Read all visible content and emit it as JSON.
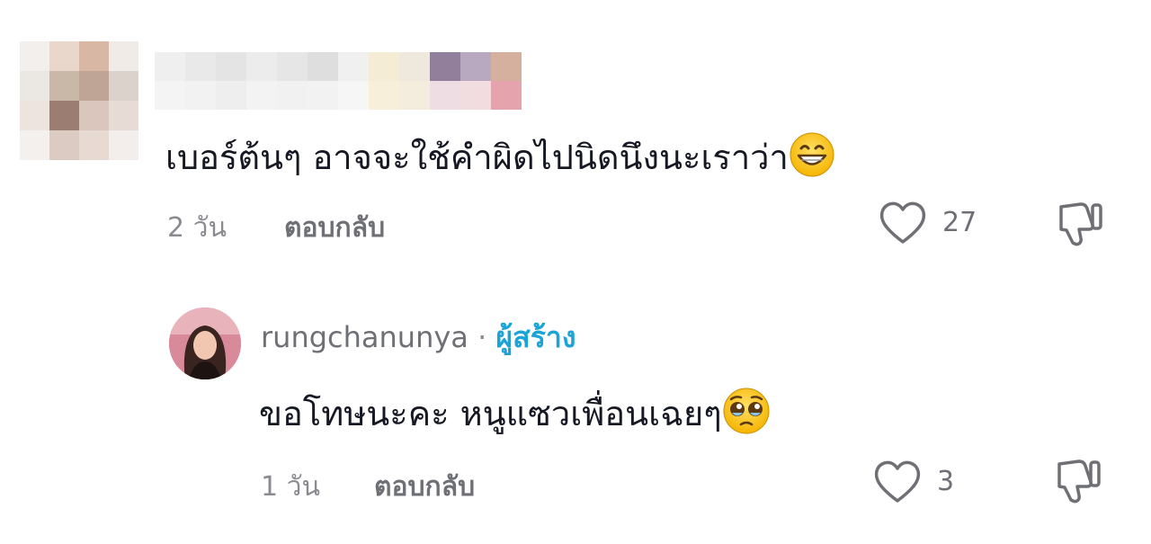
{
  "comment1": {
    "text": "เบอร์ต้นๆ อาจจะใช้คำผิดไปนิดนึงนะเราว่า",
    "emoji": "grinning-face-emoji",
    "time": "2 วัน",
    "reply_label": "ตอบกลับ",
    "like_count": "27",
    "icons": {
      "like": "heart-outline-icon",
      "dislike": "thumbs-down-outline-icon"
    }
  },
  "comment2": {
    "username": "rungchanunya",
    "separator": "·",
    "creator_badge": "ผู้สร้าง",
    "text": "ขอโทษนะคะ หนูแซวเพื่อนเฉยๆ",
    "emoji": "pleading-face-emoji",
    "time": "1 วัน",
    "reply_label": "ตอบกลับ",
    "like_count": "3",
    "icons": {
      "like": "heart-outline-icon",
      "dislike": "thumbs-down-outline-icon"
    }
  },
  "colors": {
    "text": "#161823",
    "meta": "#8a8b91",
    "creator_badge": "#1aa4d8",
    "background": "#ffffff"
  }
}
